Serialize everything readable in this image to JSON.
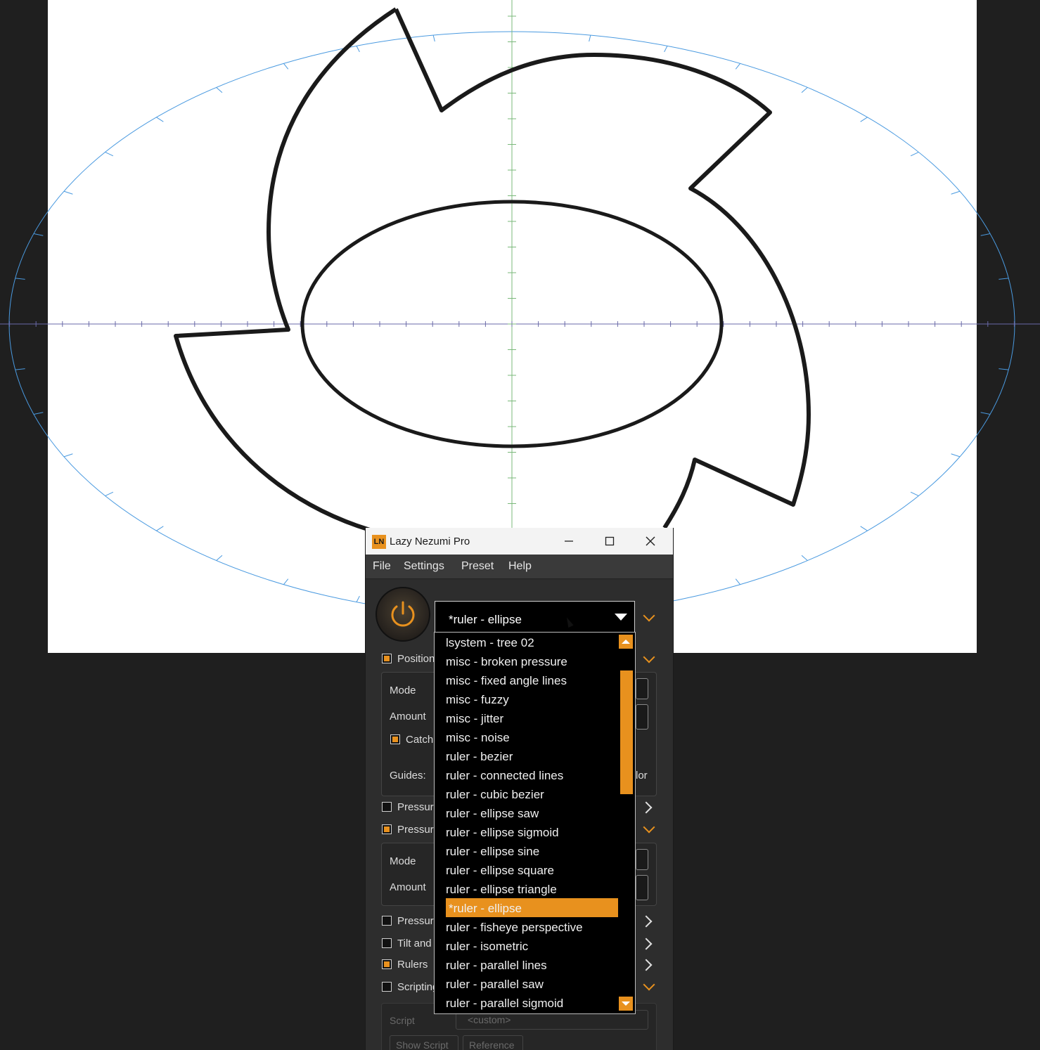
{
  "window": {
    "title": "Lazy Nezumi Pro",
    "logo": "LN",
    "minimize_icon": "minimize-icon",
    "maximize_icon": "maximize-icon",
    "close_icon": "close-icon"
  },
  "menu": {
    "file": "File",
    "settings": "Settings",
    "preset": "Preset",
    "help": "Help"
  },
  "preset": {
    "selected": "*ruler - ellipse"
  },
  "dropdown_items": [
    "lsystem - tree 02",
    "misc - broken pressure",
    "misc - fixed angle lines",
    "misc - fuzzy",
    "misc - jitter",
    "misc - noise",
    "ruler - bezier",
    "ruler - connected lines",
    "ruler - cubic bezier",
    "ruler - ellipse saw",
    "ruler - ellipse sigmoid",
    "ruler - ellipse sine",
    "ruler - ellipse square",
    "ruler - ellipse triangle",
    "*ruler - ellipse",
    "ruler - fisheye perspective",
    "ruler - isometric",
    "ruler - parallel lines",
    "ruler - parallel saw",
    "ruler - parallel sigmoid"
  ],
  "panel": {
    "position": "Position",
    "mode1": "Mode",
    "amount1": "Amount",
    "catch": "Catch",
    "guides": "Guides:",
    "guides_tail": "lor",
    "pressure1": "Pressure",
    "pressure2": "Pressure",
    "mode2": "Mode",
    "amount2": "Amount",
    "pressure3": "Pressure",
    "tilt": "Tilt and",
    "rulers": "Rulers",
    "scripting": "Scripting",
    "script_label": "Script",
    "script_value": "<custom>",
    "show_script": "Show Script",
    "reference": "Reference"
  },
  "colors": {
    "accent": "#e8911e",
    "window_bg": "#2d2d2d",
    "guide_blue": "#3d8fe0"
  }
}
